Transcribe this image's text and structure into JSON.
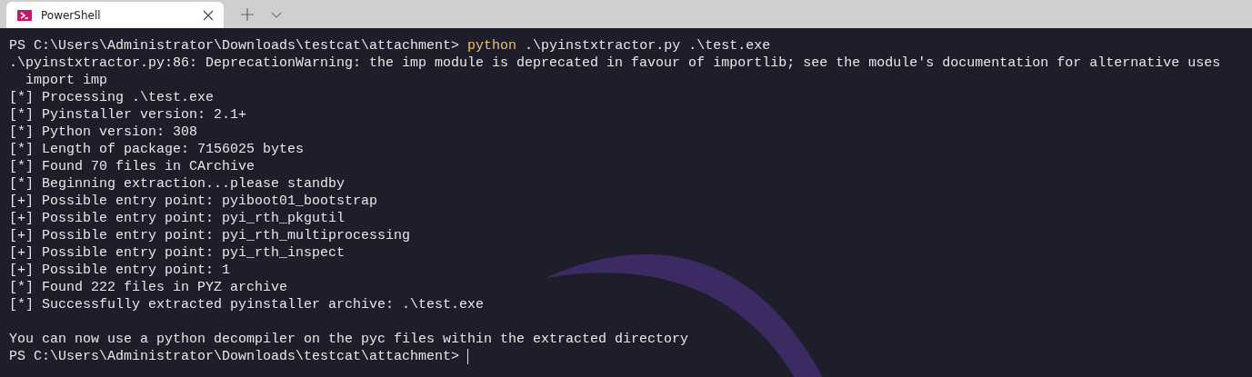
{
  "tabs": [
    {
      "title": "PowerShell",
      "selected": true
    }
  ],
  "terminal": {
    "lines": [
      {
        "kind": "prompt",
        "prompt": "PS C:\\Users\\Administrator\\Downloads\\testcat\\attachment>",
        "command": "python",
        "args": ".\\pyinstxtractor.py .\\test.exe",
        "cursor": false
      },
      {
        "kind": "output",
        "text": ".\\pyinstxtractor.py:86: DeprecationWarning: the imp module is deprecated in favour of importlib; see the module's documentation for alternative uses"
      },
      {
        "kind": "output",
        "text": "  import imp"
      },
      {
        "kind": "output",
        "text": "[*] Processing .\\test.exe"
      },
      {
        "kind": "output",
        "text": "[*] Pyinstaller version: 2.1+"
      },
      {
        "kind": "output",
        "text": "[*] Python version: 308"
      },
      {
        "kind": "output",
        "text": "[*] Length of package: 7156025 bytes"
      },
      {
        "kind": "output",
        "text": "[*] Found 70 files in CArchive"
      },
      {
        "kind": "output",
        "text": "[*] Beginning extraction...please standby"
      },
      {
        "kind": "output",
        "text": "[+] Possible entry point: pyiboot01_bootstrap"
      },
      {
        "kind": "output",
        "text": "[+] Possible entry point: pyi_rth_pkgutil"
      },
      {
        "kind": "output",
        "text": "[+] Possible entry point: pyi_rth_multiprocessing"
      },
      {
        "kind": "output",
        "text": "[+] Possible entry point: pyi_rth_inspect"
      },
      {
        "kind": "output",
        "text": "[+] Possible entry point: 1"
      },
      {
        "kind": "output",
        "text": "[*] Found 222 files in PYZ archive"
      },
      {
        "kind": "output",
        "text": "[*] Successfully extracted pyinstaller archive: .\\test.exe"
      },
      {
        "kind": "blank"
      },
      {
        "kind": "output",
        "text": "You can now use a python decompiler on the pyc files within the extracted directory"
      },
      {
        "kind": "prompt",
        "prompt": "PS C:\\Users\\Administrator\\Downloads\\testcat\\attachment>",
        "cursor": true
      }
    ]
  }
}
